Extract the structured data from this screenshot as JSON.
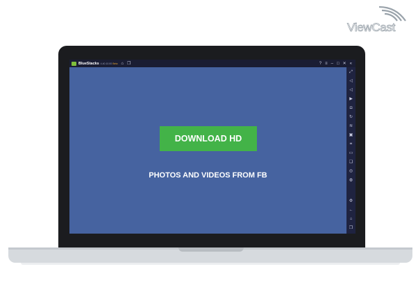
{
  "brand": {
    "logo_text": "ViewCast",
    "logo_icon": "wifi-waves-icon"
  },
  "window": {
    "app_name": "BlueStacks",
    "version": "4.40.10.00",
    "beta": "Beta",
    "title_icons": [
      "home-icon",
      "multi-instance-icon"
    ],
    "controls": [
      "help-icon",
      "menu-icon",
      "minimize-icon",
      "restore-icon",
      "close-icon",
      "collapse-icon"
    ]
  },
  "sidebar": {
    "tools": [
      "fullscreen-icon",
      "volume-up-icon",
      "volume-down-icon",
      "play-icon",
      "screenshot-icon",
      "rotate-icon",
      "shake-icon",
      "gamepad-icon",
      "keymap-icon",
      "folder-icon",
      "copy-icon",
      "macro-icon",
      "eco-icon"
    ],
    "bottom": [
      "settings-icon",
      "back-icon",
      "home-icon",
      "recents-icon"
    ]
  },
  "app": {
    "download_label": "DOWNLOAD HD",
    "subtitle": "PHOTOS AND VIDEOS FROM FB",
    "background": "#4663a0",
    "button_color": "#43b348"
  }
}
